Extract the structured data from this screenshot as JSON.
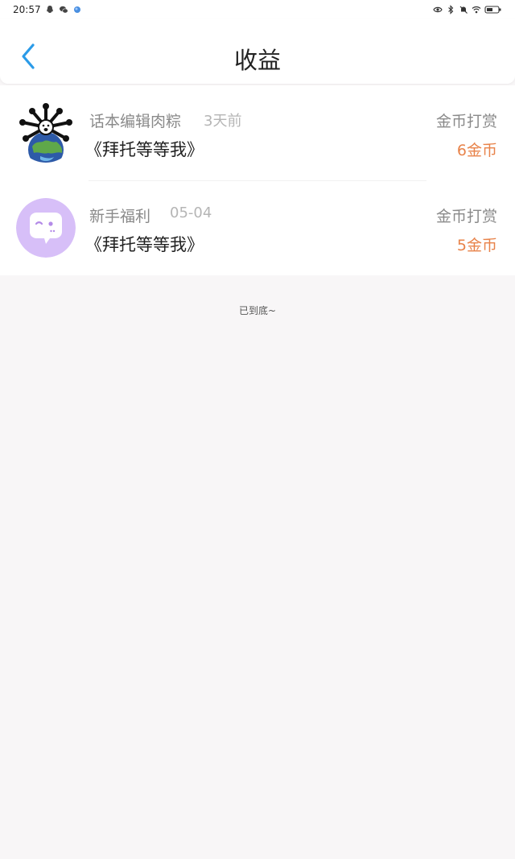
{
  "status_bar": {
    "time": "20:57",
    "left_icons": [
      "qq-icon",
      "wechat-icon",
      "app-icon"
    ],
    "right_icons": [
      "eye-icon",
      "bluetooth-icon",
      "mute-icon",
      "wifi-icon",
      "battery-icon"
    ]
  },
  "header": {
    "title": "收益",
    "back_icon": "chevron-left-icon",
    "accent_color": "#2b9be8"
  },
  "earnings": [
    {
      "sender": "话本编辑肉粽",
      "time": "3天前",
      "book": "《拜托等等我》",
      "type": "金币打赏",
      "amount": "6金币",
      "avatar": "globe-avatar-icon"
    },
    {
      "sender": "新手福利",
      "time": "05-04",
      "book": "《拜托等等我》",
      "type": "金币打赏",
      "amount": "5金币",
      "avatar": "chat-bubble-avatar-icon"
    }
  ],
  "footer": {
    "end_text": "已到底~"
  },
  "colors": {
    "amount": "#e8834a",
    "background": "#f8f6f7",
    "avatar_purple": "#d7bff8"
  }
}
